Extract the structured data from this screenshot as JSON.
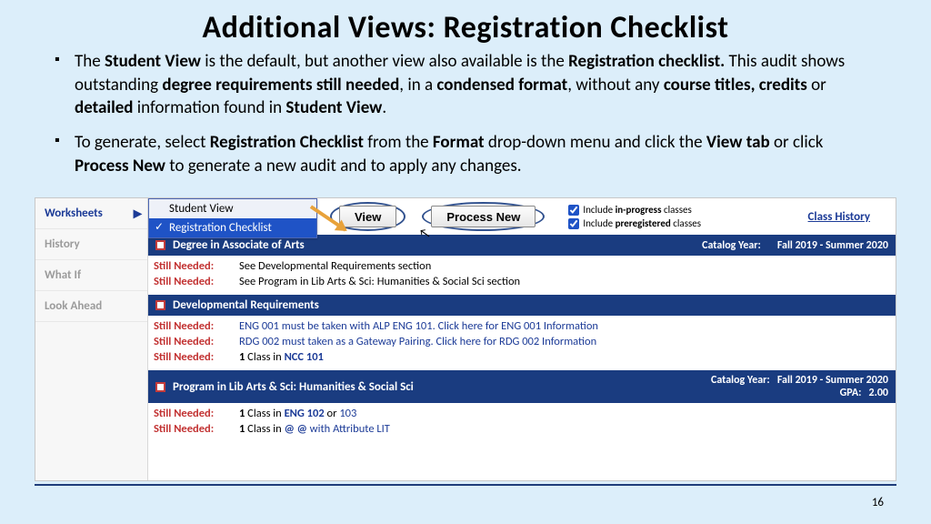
{
  "title": "Additional Views:  Registration Checklist",
  "bullets": {
    "b1": {
      "t1": "The ",
      "t2": "Student View",
      "t3": " is the default, but another view also available is the ",
      "t4": "Registration checklist.",
      "t5": " This audit shows outstanding ",
      "t6": "degree requirements still needed",
      "t7": ", in a ",
      "t8": "condensed format",
      "t9": ", without any ",
      "t10": "course titles, credits",
      "t11": " or ",
      "t12": "detailed",
      "t13": " information found in ",
      "t14": "Student View",
      "t15": "."
    },
    "b2": {
      "t1": "To generate, select ",
      "t2": "Registration Checklist",
      "t3": " from the ",
      "t4": "Format",
      "t5": " drop-down menu and click the ",
      "t6": "View tab",
      "t7": " or click ",
      "t8": "Process New",
      "t9": " to generate a new audit and to apply any changes."
    }
  },
  "sidebar": {
    "items": [
      {
        "label": "Worksheets"
      },
      {
        "label": "History"
      },
      {
        "label": "What If"
      },
      {
        "label": "Look Ahead"
      }
    ]
  },
  "dropdown": {
    "opt1": "Student View",
    "opt2": "Registration Checklist"
  },
  "toolbar": {
    "view": "View",
    "process": "Process New",
    "chk1a": "Include ",
    "chk1b": "in-progress",
    "chk1c": " classes",
    "chk2a": "Include ",
    "chk2b": "preregistered",
    "chk2c": " classes",
    "classhistory": "Class History"
  },
  "sections": {
    "s1": {
      "title": "Degree in Associate of Arts",
      "cat_lbl": "Catalog Year:",
      "cat_val": "Fall 2019 - Summer 2020",
      "rows": [
        {
          "lbl": "Still Needed:",
          "val": "See Developmental Requirements section"
        },
        {
          "lbl": "Still Needed:",
          "val": "See Program in Lib Arts & Sci: Humanities & Social Sci section"
        }
      ]
    },
    "s2": {
      "title": "Developmental Requirements",
      "rows": [
        {
          "lbl": "Still Needed:",
          "pre": "ENG 001 must be taken with ALP ENG 101. ",
          "link": "Click here for ENG 001 Information"
        },
        {
          "lbl": "Still Needed:",
          "pre": "RDG 002 must taken as a Gateway Pairing. ",
          "link": "Click here for RDG 002 Information"
        },
        {
          "lbl": "Still Needed:",
          "one": "1",
          "cls": " Class in ",
          "code": "NCC 101"
        }
      ]
    },
    "s3": {
      "title": "Program in Lib Arts & Sci: Humanities & Social Sci",
      "cat_lbl": "Catalog Year:",
      "cat_val": "Fall 2019 - Summer 2020",
      "gpa_lbl": "GPA:",
      "gpa_val": "2.00",
      "rows": [
        {
          "lbl": "Still Needed:",
          "one": "1",
          "cls": " Class in ",
          "code": "ENG 102",
          "or": " or ",
          "code2": "103"
        },
        {
          "lbl": "Still Needed:",
          "one": "1",
          "cls": " Class in ",
          "code": "@ @",
          "attr": "   with Attribute LIT"
        }
      ]
    }
  },
  "pagenum": "16"
}
